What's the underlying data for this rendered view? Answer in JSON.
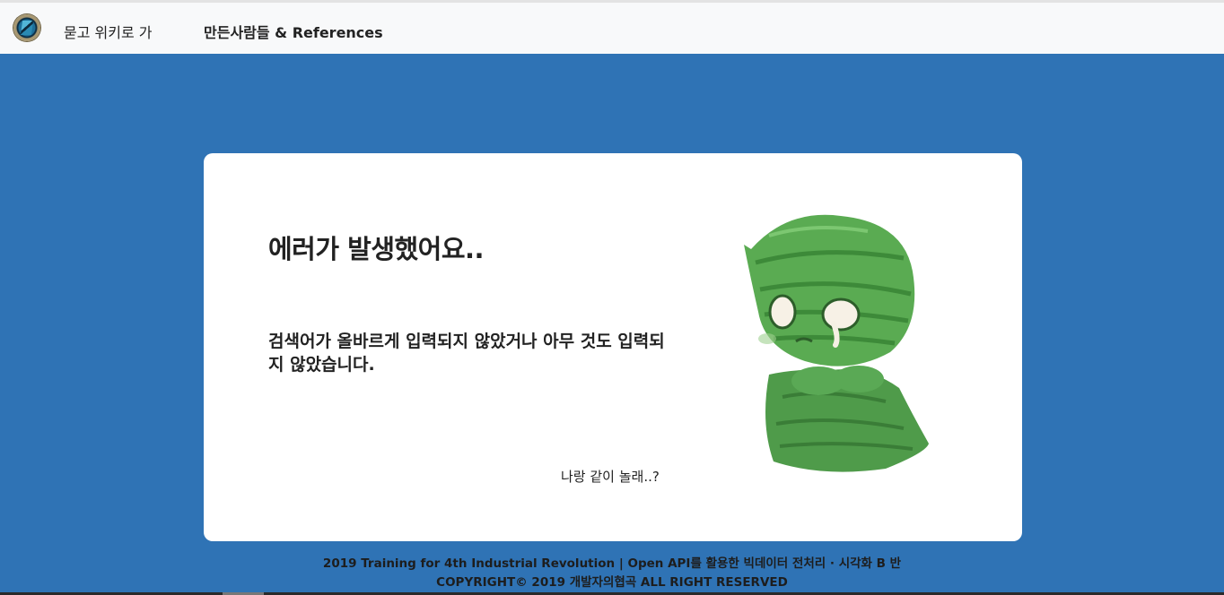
{
  "nav": {
    "home_label": "묻고 위키로 가",
    "credits_label": "만든사람들 & References"
  },
  "error": {
    "title": "에러가 발생했어요..",
    "message": "검색어가 올바르게 입력되지 않았거나 아무 것도 입력되지 않았습니다.",
    "play_link": "나랑 같이 놀래..?"
  },
  "footer": {
    "line1": "2019 Training for 4th Industrial Revolution | Open API를 활용한 빅데이터 전처리 · 시각화 B 반",
    "line2": "COPYRIGHT© 2019 개발자의협곡 ALL RIGHT RESERVED"
  },
  "colors": {
    "background": "#2f73b5",
    "card": "#ffffff",
    "navbar": "#f8f9fa"
  },
  "icons": {
    "logo": "hextech-logo-icon",
    "mascot": "crying-mummy-mascot"
  }
}
